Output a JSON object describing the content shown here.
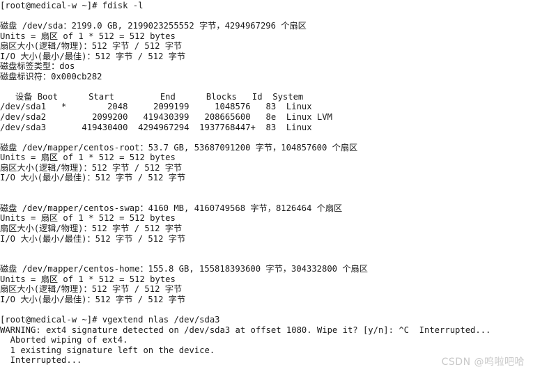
{
  "terminal": {
    "background_color": "#ffffff",
    "text_color": "#1b1b1b",
    "watermark": "CSDN @呜啦吧哈",
    "watermark_color": "#c9c9c9",
    "lines": [
      "[root@medical-w ~]# fdisk -l",
      "",
      "磁盘 /dev/sda：2199.0 GB, 2199023255552 字节，4294967296 个扇区",
      "Units = 扇区 of 1 * 512 = 512 bytes",
      "扇区大小(逻辑/物理)：512 字节 / 512 字节",
      "I/O 大小(最小/最佳)：512 字节 / 512 字节",
      "磁盘标签类型：dos",
      "磁盘标识符：0x000cb282",
      "",
      "   设备 Boot      Start         End      Blocks   Id  System",
      "/dev/sda1   *        2048     2099199     1048576   83  Linux",
      "/dev/sda2         2099200   419430399   208665600   8e  Linux LVM",
      "/dev/sda3       419430400  4294967294  1937768447+  83  Linux",
      "",
      "磁盘 /dev/mapper/centos-root：53.7 GB, 53687091200 字节，104857600 个扇区",
      "Units = 扇区 of 1 * 512 = 512 bytes",
      "扇区大小(逻辑/物理)：512 字节 / 512 字节",
      "I/O 大小(最小/最佳)：512 字节 / 512 字节",
      "",
      "",
      "磁盘 /dev/mapper/centos-swap：4160 MB, 4160749568 字节，8126464 个扇区",
      "Units = 扇区 of 1 * 512 = 512 bytes",
      "扇区大小(逻辑/物理)：512 字节 / 512 字节",
      "I/O 大小(最小/最佳)：512 字节 / 512 字节",
      "",
      "",
      "磁盘 /dev/mapper/centos-home：155.8 GB, 155818393600 字节，304332800 个扇区",
      "Units = 扇区 of 1 * 512 = 512 bytes",
      "扇区大小(逻辑/物理)：512 字节 / 512 字节",
      "I/O 大小(最小/最佳)：512 字节 / 512 字节",
      "",
      "[root@medical-w ~]# vgextend nlas /dev/sda3",
      "WARNING: ext4 signature detected on /dev/sda3 at offset 1080. Wipe it? [y/n]: ^C  Interrupted...",
      "  Aborted wiping of ext4.",
      "  1 existing signature left on the device.",
      "  Interrupted..."
    ],
    "commands": [
      {
        "prompt": "[root@medical-w ~]#",
        "command": "fdisk -l"
      },
      {
        "prompt": "[root@medical-w ~]#",
        "command": "vgextend nlas /dev/sda3"
      }
    ],
    "disks": [
      {
        "device": "/dev/sda",
        "size_human": "2199.0 GB",
        "size_bytes": "2199023255552",
        "sectors": "4294967296",
        "units": "1 * 512 = 512 bytes",
        "sector_size_logical": "512",
        "sector_size_physical": "512",
        "io_size_min": "512",
        "io_size_optimal": "512",
        "label_type": "dos",
        "identifier": "0x000cb282"
      },
      {
        "device": "/dev/mapper/centos-root",
        "size_human": "53.7 GB",
        "size_bytes": "53687091200",
        "sectors": "104857600",
        "units": "1 * 512 = 512 bytes",
        "sector_size_logical": "512",
        "sector_size_physical": "512",
        "io_size_min": "512",
        "io_size_optimal": "512"
      },
      {
        "device": "/dev/mapper/centos-swap",
        "size_human": "4160 MB",
        "size_bytes": "4160749568",
        "sectors": "8126464",
        "units": "1 * 512 = 512 bytes",
        "sector_size_logical": "512",
        "sector_size_physical": "512",
        "io_size_min": "512",
        "io_size_optimal": "512"
      },
      {
        "device": "/dev/mapper/centos-home",
        "size_human": "155.8 GB",
        "size_bytes": "155818393600",
        "sectors": "304332800",
        "units": "1 * 512 = 512 bytes",
        "sector_size_logical": "512",
        "sector_size_physical": "512",
        "io_size_min": "512",
        "io_size_optimal": "512"
      }
    ],
    "partition_table": {
      "headers": [
        "设备",
        "Boot",
        "Start",
        "End",
        "Blocks",
        "Id",
        "System"
      ],
      "rows": [
        {
          "device": "/dev/sda1",
          "boot": "*",
          "start": "2048",
          "end": "2099199",
          "blocks": "1048576",
          "id": "83",
          "system": "Linux"
        },
        {
          "device": "/dev/sda2",
          "boot": "",
          "start": "2099200",
          "end": "419430399",
          "blocks": "208665600",
          "id": "8e",
          "system": "Linux LVM"
        },
        {
          "device": "/dev/sda3",
          "boot": "",
          "start": "419430400",
          "end": "4294967294",
          "blocks": "1937768447+",
          "id": "83",
          "system": "Linux"
        }
      ]
    },
    "vgextend_output": {
      "warning": "WARNING: ext4 signature detected on /dev/sda3 at offset 1080. Wipe it? [y/n]: ^C  Interrupted...",
      "aborted": "  Aborted wiping of ext4.",
      "signature_left": "  1 existing signature left on the device.",
      "interrupted": "  Interrupted..."
    }
  }
}
